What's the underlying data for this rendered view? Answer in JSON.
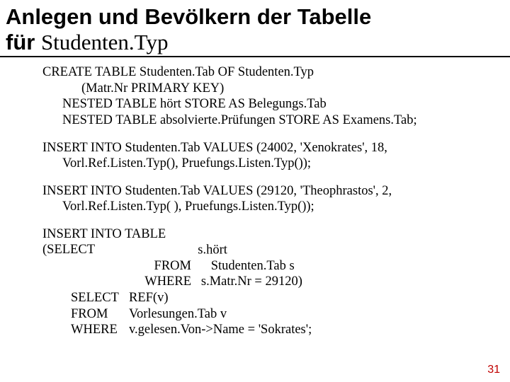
{
  "title": {
    "line1": "Anlegen und Bevölkern der Tabelle",
    "prefix2": "für ",
    "serif": "Studenten.Typ"
  },
  "create": {
    "l1": "CREATE TABLE Studenten.Tab OF Studenten.Typ",
    "l2": "(Matr.Nr PRIMARY KEY)",
    "l3": "NESTED TABLE hört STORE AS Belegungs.Tab",
    "l4": "NESTED TABLE absolvierte.Prüfungen STORE AS Examens.Tab;"
  },
  "ins1": {
    "l1": "INSERT INTO Studenten.Tab VALUES (24002, 'Xenokrates', 18,",
    "l2": "Vorl.Ref.Listen.Typ(), Pruefungs.Listen.Typ());"
  },
  "ins2": {
    "l1": "INSERT INTO Studenten.Tab VALUES (29120, 'Theophrastos', 2,",
    "l2": "Vorl.Ref.Listen.Typ( ), Pruefungs.Listen.Typ());"
  },
  "ins3": {
    "l1a": "INSERT INTO TABLE (SELECT",
    "l1b": "s.hört",
    "l2a": "FROM",
    "l2b": "Studenten.Tab s",
    "l3a": "WHERE",
    "l3b": "s.Matr.Nr = 29120)",
    "l4a": "SELECT",
    "l4b": "REF(v)",
    "l5a": "FROM",
    "l5b": "Vorlesungen.Tab v",
    "l6a": "WHERE",
    "l6b": "v.gelesen.Von->Name = 'Sokrates';"
  },
  "page": "31"
}
